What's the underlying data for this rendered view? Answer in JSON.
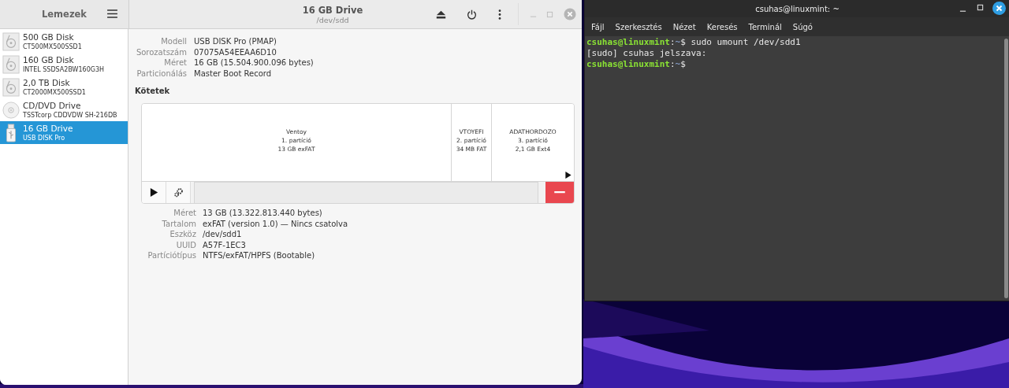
{
  "disks_window": {
    "sidebar_title": "Lemezek",
    "title": "16 GB Drive",
    "subtitle": "/dev/sdd",
    "devices": [
      {
        "name": "500 GB Disk",
        "model": "CT500MX500SSD1",
        "kind": "hdd",
        "selected": false
      },
      {
        "name": "160 GB Disk",
        "model": "INTEL SSDSA2BW160G3H",
        "kind": "hdd",
        "selected": false
      },
      {
        "name": "2,0 TB Disk",
        "model": "CT2000MX500SSD1",
        "kind": "hdd",
        "selected": false
      },
      {
        "name": "CD/DVD Drive",
        "model": "TSSTcorp CDDVDW SH-216DB",
        "kind": "optical",
        "selected": false
      },
      {
        "name": "16 GB Drive",
        "model": "USB DISK Pro",
        "kind": "usb",
        "selected": true
      }
    ],
    "drive_properties": [
      {
        "label": "Modell",
        "value": "USB DISK Pro (PMAP)"
      },
      {
        "label": "Sorozatszám",
        "value": "07075A54EEAA6D10"
      },
      {
        "label": "Méret",
        "value": "16 GB (15.504.900.096 bytes)"
      },
      {
        "label": "Particionálás",
        "value": "Master Boot Record"
      }
    ],
    "volumes_heading": "Kötetek",
    "partitions": [
      {
        "name": "Ventoy",
        "number": "1. partíció",
        "info": "13 GB exFAT"
      },
      {
        "name": "VTOYEFI",
        "number": "2. partíció",
        "info": "34 MB FAT"
      },
      {
        "name": "ADATHORDOZO",
        "number": "3. partíció",
        "info": "2,1 GB Ext4"
      }
    ],
    "volume_properties": [
      {
        "label": "Méret",
        "value": "13 GB (13.322.813.440 bytes)"
      },
      {
        "label": "Tartalom",
        "value": "exFAT (version 1.0) — Nincs csatolva"
      },
      {
        "label": "Eszköz",
        "value": "/dev/sdd1"
      },
      {
        "label": "UUID",
        "value": "A57F-1EC3"
      },
      {
        "label": "Partíciótípus",
        "value": "NTFS/exFAT/HPFS (Bootable)"
      }
    ]
  },
  "terminal": {
    "title": "csuhas@linuxmint: ~",
    "menu": [
      "Fájl",
      "Szerkesztés",
      "Nézet",
      "Keresés",
      "Terminál",
      "Súgó"
    ],
    "lines": [
      [
        {
          "kind": "user",
          "text": "csuhas@linuxmint"
        },
        {
          "kind": "plain",
          "text": ":"
        },
        {
          "kind": "path",
          "text": "~"
        },
        {
          "kind": "plain",
          "text": "$ sudo umount /dev/sdd1"
        }
      ],
      [
        {
          "kind": "plain",
          "text": "[sudo] csuhas jelszava:"
        }
      ],
      [
        {
          "kind": "user",
          "text": "csuhas@linuxmint"
        },
        {
          "kind": "plain",
          "text": ":"
        },
        {
          "kind": "path",
          "text": "~"
        },
        {
          "kind": "plain",
          "text": "$"
        }
      ]
    ]
  }
}
